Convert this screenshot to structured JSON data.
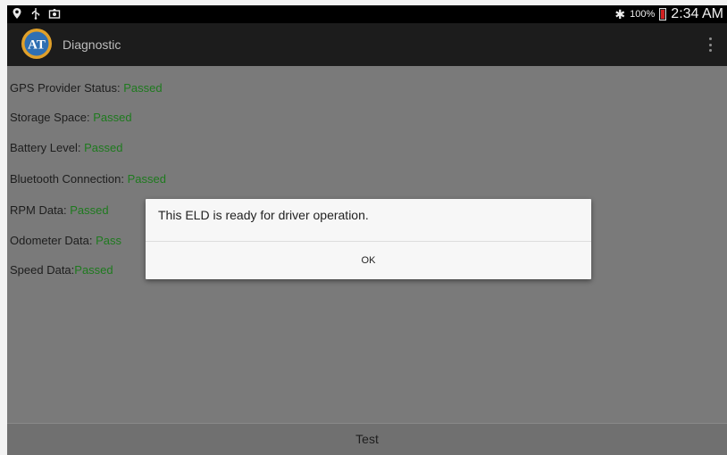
{
  "status_bar": {
    "icons": [
      "location-icon",
      "usb-icon",
      "screenshot-icon"
    ],
    "bluetooth_icon": "bluetooth-icon",
    "battery_percent": "100%",
    "time": "2:34 AM"
  },
  "action_bar": {
    "logo_text": "AT",
    "title": "Diagnostic",
    "overflow_icon": "overflow-menu-icon"
  },
  "checks": [
    {
      "label": "GPS Provider Status:",
      "value": "Passed"
    },
    {
      "label": "Storage Space:",
      "value": "Passed"
    },
    {
      "label": "Battery Level:",
      "value": "Passed"
    },
    {
      "label": "Bluetooth Connection:",
      "value": "Passed"
    },
    {
      "label": "RPM Data:",
      "value": "Passed"
    },
    {
      "label": "Odometer Data:",
      "value": "Pass"
    },
    {
      "label": "Speed Data:",
      "value": "Passed"
    }
  ],
  "dialog": {
    "message": "This ELD is ready for driver operation.",
    "ok_label": "OK"
  },
  "bottom": {
    "test_label": "Test"
  },
  "colors": {
    "passed": "#1e7a1e",
    "background": "#7a7a7a",
    "action_bar": "#1c1c1c"
  }
}
